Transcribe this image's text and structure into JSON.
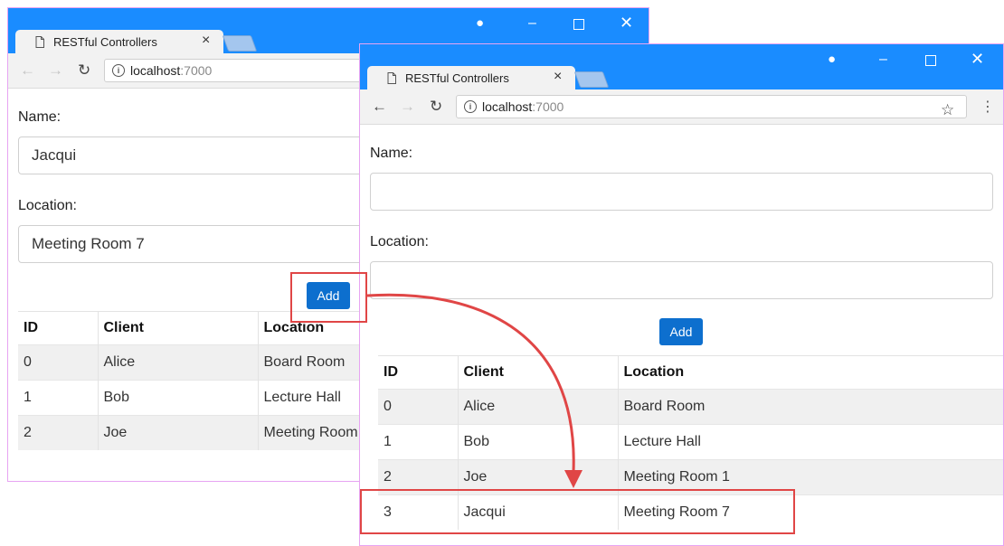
{
  "tab_title": "RESTful Controllers",
  "url_host": "localhost",
  "url_port": ":7000",
  "form": {
    "name_label": "Name:",
    "location_label": "Location:",
    "add_label": "Add"
  },
  "table": {
    "headers": [
      "ID",
      "Client",
      "Location"
    ]
  },
  "back_window": {
    "name_value": "Jacqui",
    "location_value": "Meeting Room 7",
    "rows": [
      [
        "0",
        "Alice",
        "Board Room"
      ],
      [
        "1",
        "Bob",
        "Lecture Hall"
      ],
      [
        "2",
        "Joe",
        "Meeting Room 1"
      ]
    ]
  },
  "front_window": {
    "name_value": "",
    "location_value": "",
    "rows": [
      [
        "0",
        "Alice",
        "Board Room"
      ],
      [
        "1",
        "Bob",
        "Lecture Hall"
      ],
      [
        "2",
        "Joe",
        "Meeting Room 1"
      ],
      [
        "3",
        "Jacqui",
        "Meeting Room 7"
      ]
    ]
  },
  "colors": {
    "titlebar": "#1a8cff",
    "button": "#0d6fce",
    "callout": "#e04646"
  },
  "icons": {
    "tab": "page-icon",
    "close_tab": "close-icon",
    "back": "arrow-left-icon",
    "forward": "arrow-right-icon",
    "reload": "reload-icon",
    "info": "info-icon",
    "bookmark": "star-icon",
    "menu": "more-vertical-icon",
    "account": "account-icon",
    "minimize": "minimize-icon",
    "maximize": "maximize-icon",
    "close_window": "close-icon"
  }
}
